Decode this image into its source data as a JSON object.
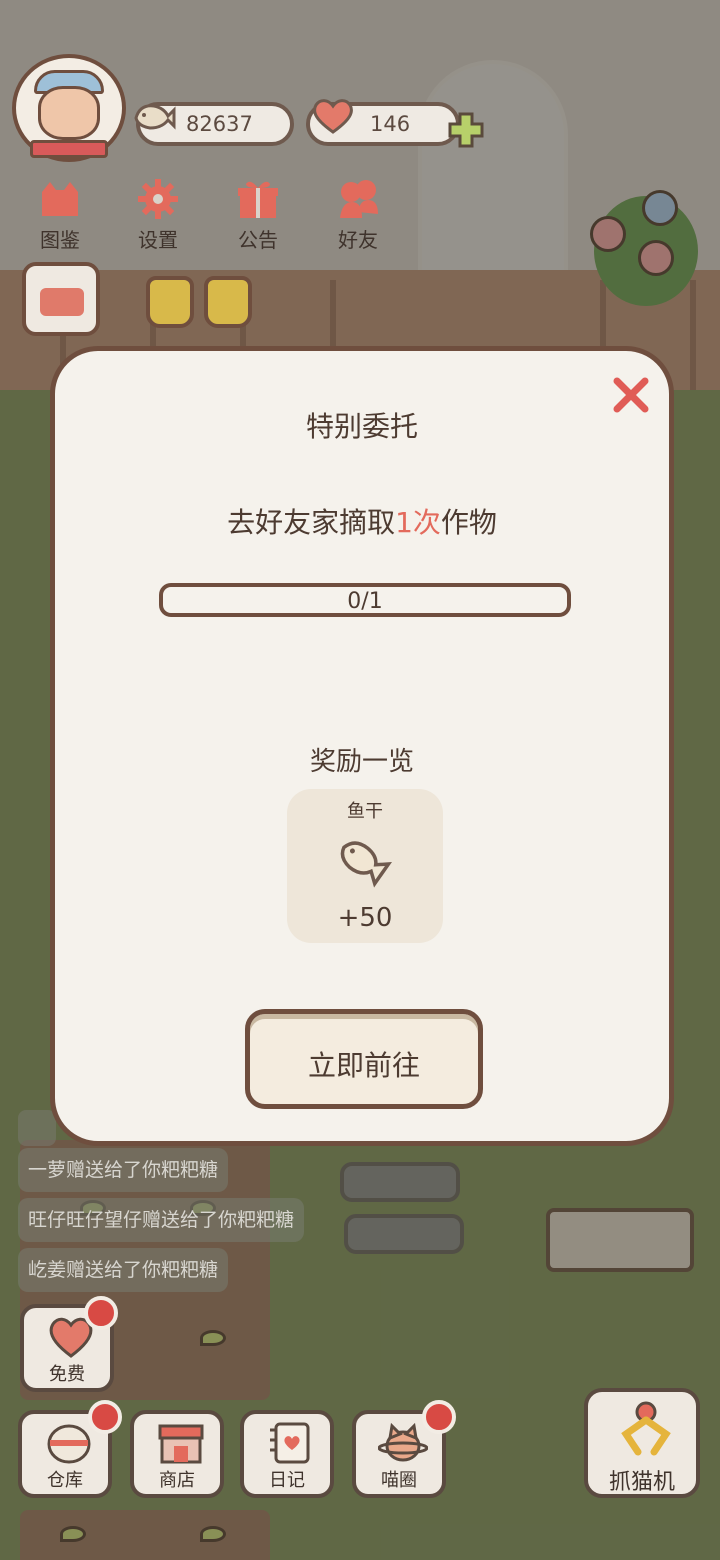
{
  "hud": {
    "fish_count": "82637",
    "heart_count": "146"
  },
  "menu": [
    {
      "label": "图鉴",
      "icon": "cat-book-icon"
    },
    {
      "label": "设置",
      "icon": "gear-icon"
    },
    {
      "label": "公告",
      "icon": "gift-icon"
    },
    {
      "label": "好友",
      "icon": "friends-icon"
    }
  ],
  "dialog": {
    "title": "特别委托",
    "task_prefix": "去好友家摘取",
    "task_highlight": "1次",
    "task_suffix": "作物",
    "progress_text": "0/1",
    "progress_fraction": 0,
    "reward_title": "奖励一览",
    "reward": {
      "name": "鱼干",
      "amount": "+50",
      "icon": "dried-fish-icon"
    },
    "go_button": "立即前往"
  },
  "chat": [
    "一萝赠送给了你粑粑糖",
    "旺仔旺仔望仔赠送给了你粑粑糖",
    "屹姜赠送给了你粑粑糖"
  ],
  "bottom": {
    "free": "免费",
    "warehouse": "仓库",
    "shop": "商店",
    "diary": "日记",
    "circle": "喵圈",
    "claw": "抓猫机"
  },
  "colors": {
    "accent": "#e36a5c",
    "border": "#6f4e3e",
    "panel": "#f5f2ec"
  }
}
